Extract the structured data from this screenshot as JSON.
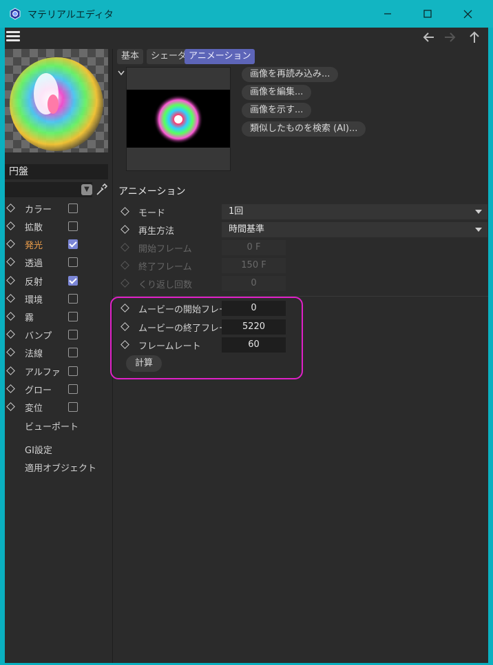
{
  "window": {
    "title": "マテリアルエディタ",
    "controls": [
      "minimize",
      "maximize",
      "close"
    ]
  },
  "toolbar": {
    "menu_icon": "hamburger-icon",
    "nav": [
      "back-arrow-icon",
      "forward-arrow-icon",
      "up-arrow-icon"
    ]
  },
  "material": {
    "name": "円盤"
  },
  "channels": [
    {
      "label": "カラー",
      "checked": false,
      "active": false
    },
    {
      "label": "拡散",
      "checked": false,
      "active": false
    },
    {
      "label": "発光",
      "checked": true,
      "active": true
    },
    {
      "label": "透過",
      "checked": false,
      "active": false
    },
    {
      "label": "反射",
      "checked": true,
      "active": false
    },
    {
      "label": "環境",
      "checked": false,
      "active": false
    },
    {
      "label": "霧",
      "checked": false,
      "active": false
    },
    {
      "label": "バンプ",
      "checked": false,
      "active": false
    },
    {
      "label": "法線",
      "checked": false,
      "active": false
    },
    {
      "label": "アルファ",
      "checked": false,
      "active": false
    },
    {
      "label": "グロー",
      "checked": false,
      "active": false
    },
    {
      "label": "変位",
      "checked": false,
      "active": false
    }
  ],
  "left_extra": [
    "ビューポート",
    "GI設定",
    "適用オブジェクト"
  ],
  "tabs": [
    {
      "label": "基本",
      "active": false
    },
    {
      "label": "シェーダ",
      "active": false
    },
    {
      "label": "アニメーション",
      "active": true
    }
  ],
  "image_buttons": [
    "画像を再読み込み...",
    "画像を編集...",
    "画像を示す...",
    "類似したものを検索 (AI)..."
  ],
  "section_title": "アニメーション",
  "mode": {
    "label": "モード",
    "value": "1回"
  },
  "timing": {
    "label": "再生方法",
    "value": "時間基準"
  },
  "dim_props": [
    {
      "label": "開始フレーム",
      "value": "0 F"
    },
    {
      "label": "終了フレーム",
      "value": "150 F"
    },
    {
      "label": "くり返し回数",
      "value": "0"
    }
  ],
  "movie_props": [
    {
      "label": "ムービーの開始フレーム",
      "value": "0"
    },
    {
      "label": "ムービーの終了フレーム",
      "value": "5220"
    },
    {
      "label": "フレームレート",
      "value": "60"
    }
  ],
  "calc_button": "計算",
  "colors": {
    "accent_tab": "#5d65b8",
    "titlebar": "#12b5c2",
    "highlight": "#e020c8",
    "active_channel": "#f0a04b"
  }
}
